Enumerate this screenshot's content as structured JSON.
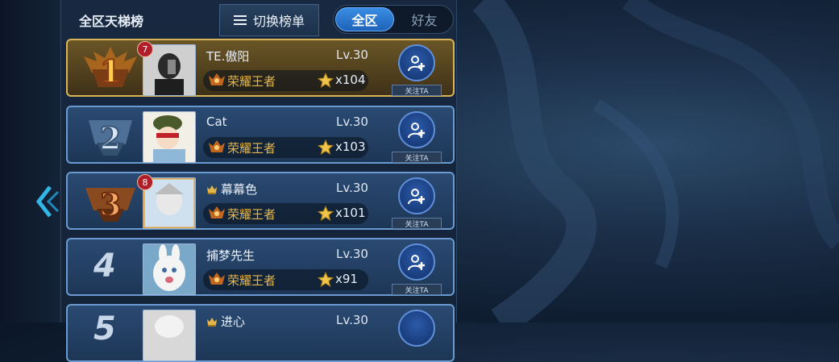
{
  "header": {
    "title": "全区天梯榜",
    "switch_label": "切换榜单",
    "segments": [
      {
        "label": "全区",
        "active": true
      },
      {
        "label": "好友",
        "active": false
      }
    ]
  },
  "rows": [
    {
      "rank": "1",
      "badge_level": "7",
      "name": "TE.傲阳",
      "level": "Lv.30",
      "tier": "荣耀王者",
      "stars": "x104",
      "follow": "关注TA",
      "crown": false
    },
    {
      "rank": "2",
      "badge_level": "",
      "name": "Cat",
      "level": "Lv.30",
      "tier": "荣耀王者",
      "stars": "x103",
      "follow": "关注TA",
      "crown": false
    },
    {
      "rank": "3",
      "badge_level": "8",
      "name": "幕幕色",
      "level": "Lv.30",
      "tier": "荣耀王者",
      "stars": "x101",
      "follow": "关注TA",
      "crown": true
    },
    {
      "rank": "4",
      "badge_level": "",
      "name": "捕梦先生",
      "level": "Lv.30",
      "tier": "荣耀王者",
      "stars": "x91",
      "follow": "关注TA",
      "crown": false
    },
    {
      "rank": "5",
      "badge_level": "",
      "name": "进心",
      "level": "Lv.30",
      "tier": "",
      "stars": "",
      "follow": "",
      "crown": true
    }
  ],
  "colors": {
    "gold": "#d8b458",
    "blue_border": "#6a9bd0",
    "tier_text": "#e5b64a",
    "accent": "#3a8ee4"
  },
  "icons": {
    "back": "chevron-left-icon",
    "list": "list-icon",
    "follow": "add-user-icon",
    "star": "star-icon",
    "tier": "king-tier-icon"
  }
}
